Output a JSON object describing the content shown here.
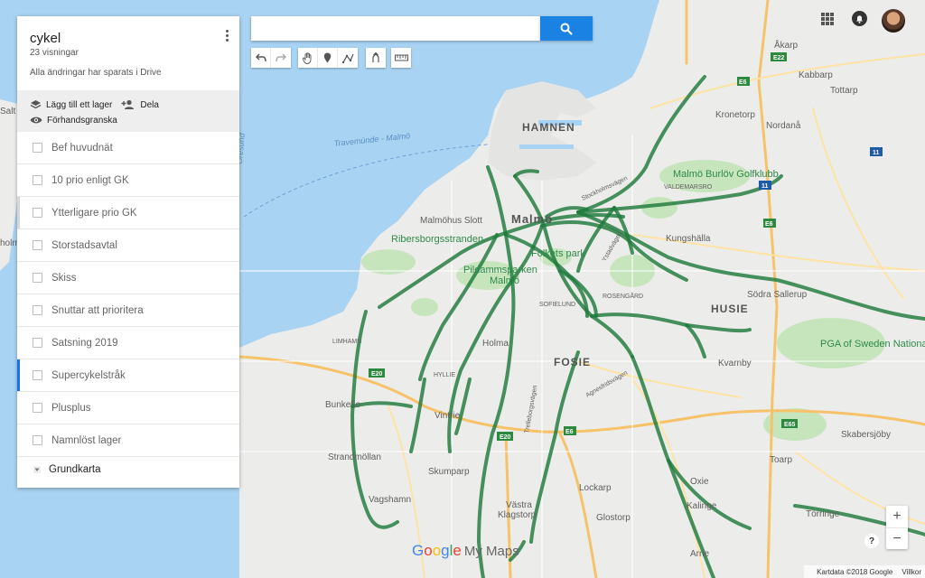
{
  "panel": {
    "title": "cykel",
    "views": "23 visningar",
    "save_status": "Alla ändringar har sparats i Drive",
    "add_layer_label": "Lägg till ett lager",
    "share_label": "Dela",
    "preview_label": "Förhandsgranska",
    "layers": [
      {
        "label": "Bef huvudnät"
      },
      {
        "label": "10 prio enligt GK"
      },
      {
        "label": "Ytterligare prio GK"
      },
      {
        "label": "Storstadsavtal"
      },
      {
        "label": "Skiss"
      },
      {
        "label": "Snuttar att prioritera"
      },
      {
        "label": "Satsning 2019"
      },
      {
        "label": "Supercykelstråk"
      },
      {
        "label": "Plusplus"
      },
      {
        "label": "Namnlöst lager"
      }
    ],
    "basemap_label": "Grundkarta"
  },
  "search": {
    "value": "",
    "placeholder": ""
  },
  "map": {
    "labels": {
      "hamnen": "HAMNEN",
      "malmo": "Malmö",
      "malmohus": "Malmöhus Slott",
      "ribersborg": "Ribersborgsstranden",
      "pildam": "Pildammsparken",
      "pildam2": "Malmö",
      "folkets": "Folkets park",
      "kungshalla": "Kungshälla",
      "husie": "HUSIE",
      "fosie": "FOSIE",
      "holma": "Holma",
      "vintrie": "Vintrie",
      "bunkeflo": "Bunkeflo",
      "strandmo": "Strandmöllan",
      "skumparp": "Skumparp",
      "vagshamn": "Vagshamn",
      "vastra": "Västra",
      "klagstorp": "Klagstorp",
      "glostorp": "Glostorp",
      "lockarp": "Lockarp",
      "kvarnby": "Kvarnby",
      "toarp": "Toarp",
      "torring": "Törringe",
      "skabers": "Skabersjöby",
      "oxie": "Oxie",
      "arrie": "Arrie",
      "kabbarp": "Kabbarp",
      "tottarp": "Tottarp",
      "akarp": "Åkarp",
      "kronetorp": "Kronetorp",
      "nordana": "Nordanå",
      "sodra_sall": "Södra Sallerup",
      "burlov_golf": "Malmö Burlöv Golfklubb",
      "pga": "PGA of Sweden National",
      "limhamn": "LIMHAMN",
      "hyllie": "HYLLIE",
      "kalinge": "Kalinge",
      "oresund": "Öresund",
      "travemunde": "Travemünde - Malmö",
      "salt": "Salt",
      "holm": "holm",
      "vallemarsro": "VALDEMARSRO",
      "sofielund": "SOFIELUND",
      "rosengard": "ROSENGÅRD",
      "stockholmsv": "Stockholmsvägen",
      "ystadv": "Ystadvägen",
      "trelleborgsv": "Trelleborgsvägen",
      "agnesfridsv": "Agnesfridsvägen",
      "e20": "E20",
      "e22": "E22",
      "e6": "E6",
      "e65": "E65",
      "n11": "11"
    },
    "route_color": "#1e7a3c",
    "water_color": "#a9d3f3",
    "land_color": "#ececea"
  },
  "logo": {
    "google": "Google",
    "mymaps": "My Maps"
  },
  "footer": {
    "attribution": "Kartdata ©2018 Google",
    "terms": "Villkor"
  },
  "icons": {
    "undo": "undo-icon",
    "redo": "redo-icon",
    "hand": "hand-icon",
    "marker": "marker-icon",
    "line": "line-icon",
    "directions": "directions-icon",
    "ruler": "ruler-icon",
    "search": "search-icon",
    "apps": "apps-icon",
    "bell": "bell-icon"
  },
  "zoom": {
    "in": "+",
    "out": "−",
    "help": "?"
  }
}
